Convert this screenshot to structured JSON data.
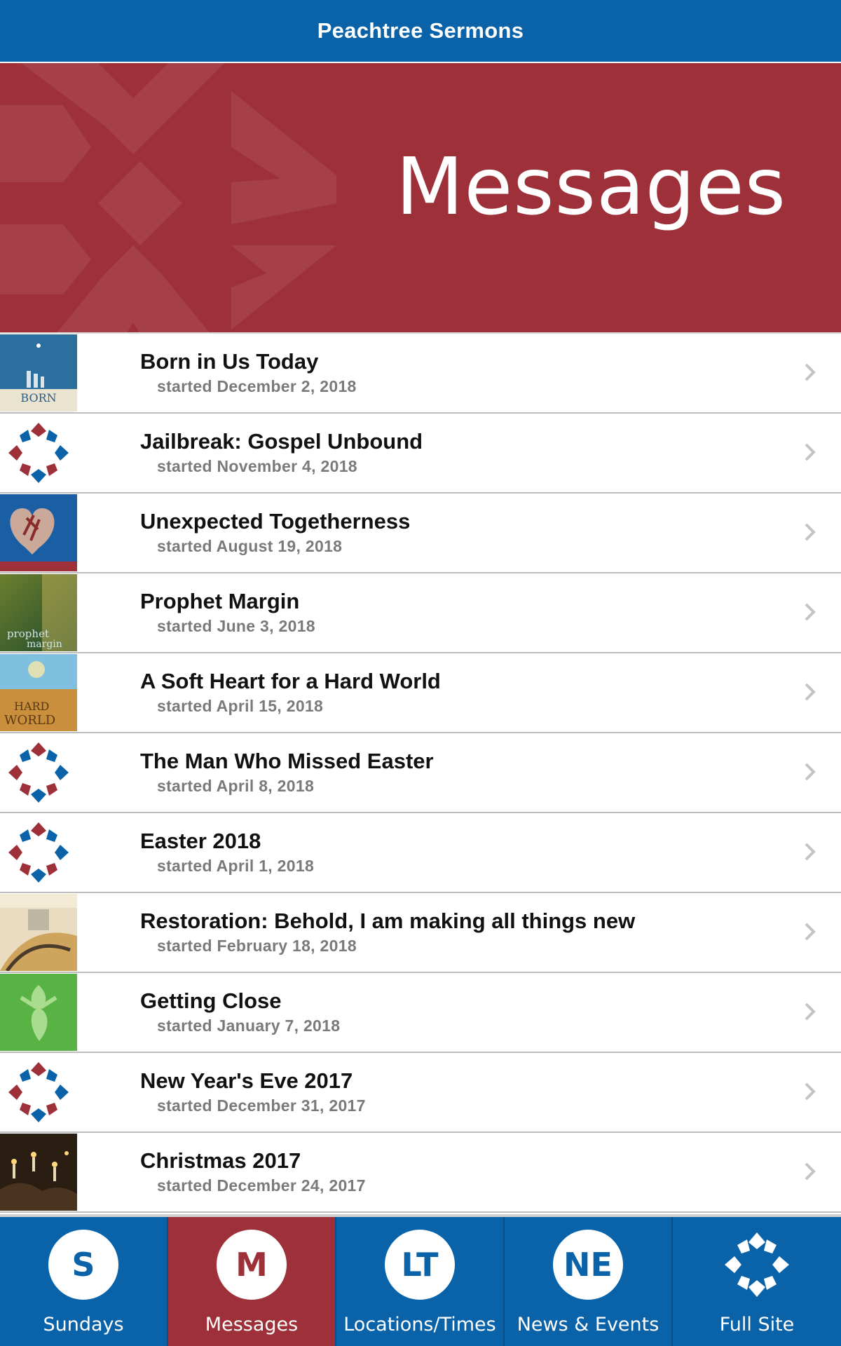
{
  "app": {
    "title": "Peachtree Sermons"
  },
  "hero": {
    "title": "Messages",
    "background_color": "#9e3039"
  },
  "messages": [
    {
      "title": "Born in Us Today",
      "subtitle": "started December 2, 2018",
      "thumb": "born-artwork"
    },
    {
      "title": "Jailbreak: Gospel Unbound",
      "subtitle": "started November 4, 2018",
      "thumb": "church-logo"
    },
    {
      "title": "Unexpected Togetherness",
      "subtitle": "started August 19, 2018",
      "thumb": "heart-artwork"
    },
    {
      "title": "Prophet Margin",
      "subtitle": "started June 3, 2018",
      "thumb": "prophet-artwork"
    },
    {
      "title": "A Soft Heart for a Hard World",
      "subtitle": "started April 15, 2018",
      "thumb": "field-artwork"
    },
    {
      "title": "The Man Who Missed Easter",
      "subtitle": "started April 8, 2018",
      "thumb": "church-logo"
    },
    {
      "title": "Easter 2018",
      "subtitle": "started April 1, 2018",
      "thumb": "church-logo"
    },
    {
      "title": "Restoration: Behold, I am making all things new",
      "subtitle": "started February 18, 2018",
      "thumb": "restoration-artwork"
    },
    {
      "title": "Getting Close",
      "subtitle": "started January 7, 2018",
      "thumb": "green-artwork"
    },
    {
      "title": "New Year's Eve 2017",
      "subtitle": "started December 31, 2017",
      "thumb": "church-logo"
    },
    {
      "title": "Christmas 2017",
      "subtitle": "started December 24, 2017",
      "thumb": "candles-artwork"
    }
  ],
  "tabs": [
    {
      "initials": "S",
      "label": "Sundays",
      "active": false
    },
    {
      "initials": "M",
      "label": "Messages",
      "active": true
    },
    {
      "initials": "LT",
      "label": "Locations/Times",
      "active": false
    },
    {
      "initials": "NE",
      "label": "News & Events",
      "active": false
    },
    {
      "icon": "church-logo-icon",
      "label": "Full Site",
      "active": false
    }
  ],
  "colors": {
    "brand_blue": "#0a63a8",
    "brand_red": "#9e3039"
  }
}
